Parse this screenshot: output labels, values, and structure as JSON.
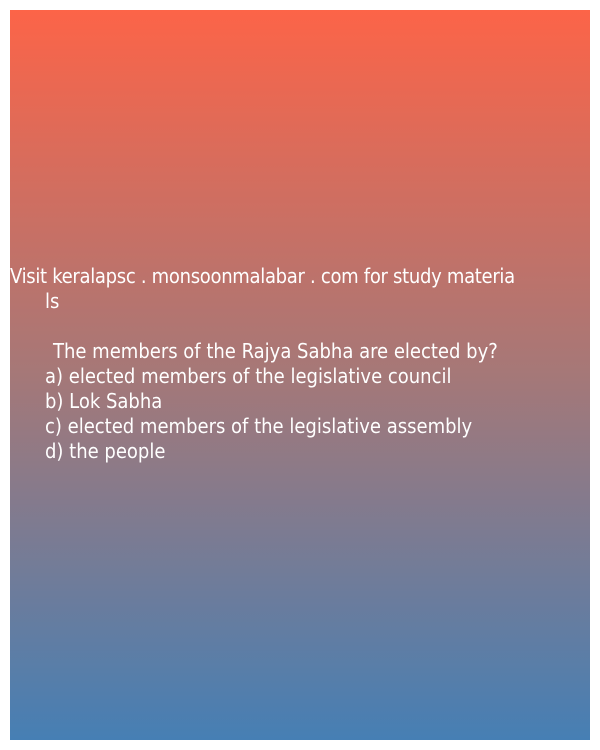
{
  "promo": {
    "line1": "Visit keralapsc . monsoonmalabar . com for study materia",
    "line2": "ls"
  },
  "question": {
    "text": "The members of the Rajya Sabha are elected by?",
    "options": [
      "a) elected members of the legislative council",
      "b) Lok Sabha",
      "c) elected members of the legislative assembly",
      "d) the people"
    ]
  },
  "colors": {
    "gradient_top": "#fc6448",
    "gradient_middle": "#a57878",
    "gradient_bottom": "#467fb4",
    "text": "#ffffff"
  }
}
